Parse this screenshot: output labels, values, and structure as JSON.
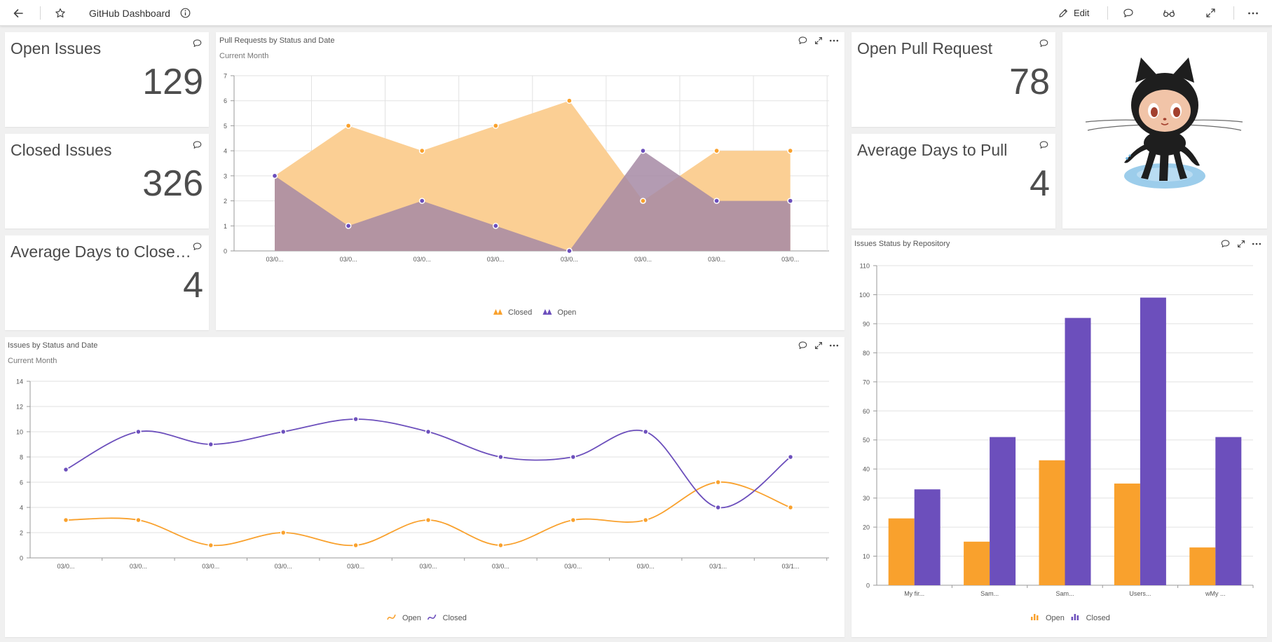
{
  "header": {
    "title": "GitHub Dashboard",
    "edit_label": "Edit"
  },
  "icons": {
    "back": "arrow-left-icon",
    "favorite": "star-icon",
    "info": "info-icon",
    "edit": "pencil-icon",
    "comment": "comment-icon",
    "view": "glasses-icon",
    "fullscreen": "expand-icon",
    "more": "more-horizontal-icon"
  },
  "colors": {
    "orange": "#f9a12d",
    "purple": "#6c4fbc",
    "orange_fill": "#fbcf94",
    "purple_fill": "#a689a5"
  },
  "kpis": {
    "open_issues": {
      "title": "Open Issues",
      "value": "129"
    },
    "closed_issues": {
      "title": "Closed Issues",
      "value": "326"
    },
    "avg_close": {
      "title": "Average Days to Close an I...",
      "value": "4"
    },
    "open_pr": {
      "title": "Open Pull Request",
      "value": "78"
    },
    "avg_pull": {
      "title": "Average Days to Pull",
      "value": "4"
    }
  },
  "widgets": {
    "pr_chart": {
      "title": "Pull Requests by Status and Date",
      "subtitle": "Current Month"
    },
    "issues_chart": {
      "title": "Issues by Status and Date",
      "subtitle": "Current Month"
    },
    "repo_chart": {
      "title": "Issues Status by Repository"
    }
  },
  "mascot": {
    "name": "octocat"
  },
  "chart_data": [
    {
      "id": "pr",
      "type": "area",
      "title": "Pull Requests by Status and Date",
      "subtitle": "Current Month",
      "categories": [
        "03/0...",
        "03/0...",
        "03/0...",
        "03/0...",
        "03/0...",
        "03/0...",
        "03/0...",
        "03/0..."
      ],
      "x": [
        0,
        1,
        2,
        3,
        4,
        5,
        6,
        7
      ],
      "ylim": [
        0,
        7
      ],
      "yticks": [
        0,
        1,
        2,
        3,
        4,
        5,
        6,
        7
      ],
      "grid": true,
      "legend": "bottom",
      "series": [
        {
          "name": "Closed",
          "color": "#f9a12d",
          "fill": "#fbcf94",
          "values": [
            3,
            5,
            4,
            5,
            6,
            2,
            4,
            4
          ]
        },
        {
          "name": "Open",
          "color": "#6c4fbc",
          "fill": "#a689a5",
          "values": [
            3,
            1,
            2,
            1,
            0,
            4,
            2,
            2
          ]
        }
      ]
    },
    {
      "id": "issues",
      "type": "line",
      "title": "Issues by Status and Date",
      "subtitle": "Current Month",
      "categories": [
        "03/0...",
        "03/0...",
        "03/0...",
        "03/0...",
        "03/0...",
        "03/0...",
        "03/0...",
        "03/0...",
        "03/0...",
        "03/1...",
        "03/1..."
      ],
      "x": [
        0,
        1,
        2,
        3,
        4,
        5,
        6,
        7,
        8,
        9,
        10
      ],
      "ylim": [
        0,
        14
      ],
      "yticks": [
        0,
        2,
        4,
        6,
        8,
        10,
        12,
        14
      ],
      "grid": true,
      "smooth": true,
      "legend": "bottom",
      "series": [
        {
          "name": "Open",
          "color": "#f9a12d",
          "values": [
            3,
            3,
            1,
            2,
            1,
            3,
            1,
            3,
            3,
            6,
            4
          ]
        },
        {
          "name": "Closed",
          "color": "#6c4fbc",
          "values": [
            7,
            10,
            9,
            10,
            11,
            10,
            8,
            8,
            10,
            4,
            8
          ]
        }
      ]
    },
    {
      "id": "repo",
      "type": "bar",
      "title": "Issues Status by Repository",
      "categories": [
        "My fir...",
        "Sam...",
        "Sam...",
        "Users...",
        "wMy ..."
      ],
      "ylim": [
        0,
        110
      ],
      "yticks": [
        0,
        10,
        20,
        30,
        40,
        50,
        60,
        70,
        80,
        90,
        100,
        110
      ],
      "grid": true,
      "legend": "bottom",
      "series": [
        {
          "name": "Open",
          "color": "#f9a12d",
          "values": [
            23,
            15,
            43,
            35,
            13
          ]
        },
        {
          "name": "Closed",
          "color": "#6c4fbc",
          "values": [
            33,
            51,
            92,
            99,
            51
          ]
        }
      ]
    }
  ]
}
